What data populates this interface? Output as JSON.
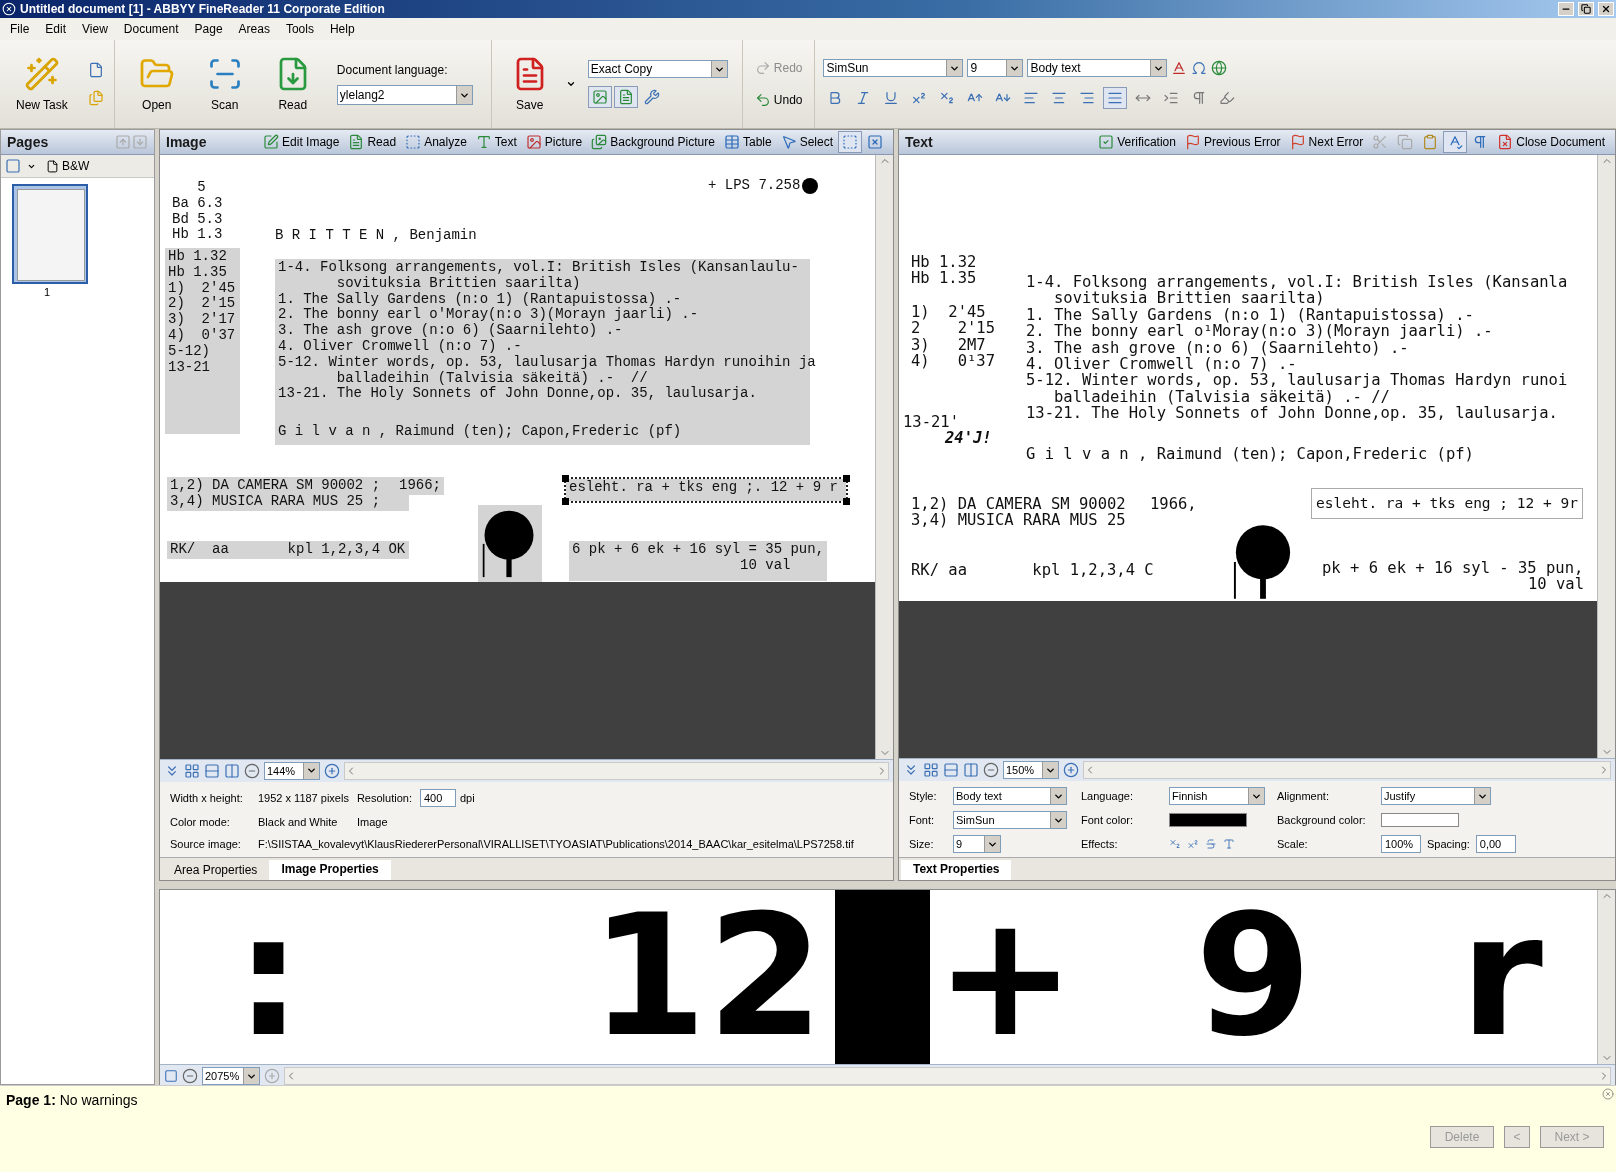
{
  "window": {
    "title": "Untitled document [1] - ABBYY FineReader 11 Corporate Edition"
  },
  "menu": [
    "File",
    "Edit",
    "View",
    "Document",
    "Page",
    "Areas",
    "Tools",
    "Help"
  ],
  "toolbar": {
    "new_task": "New Task",
    "open": "Open",
    "scan": "Scan",
    "read": "Read",
    "language_label": "Document language:",
    "language": "ylelang2",
    "save": "Save",
    "save_mode": "Exact Copy",
    "save_views": [
      {
        "kind": "picture",
        "selected": true
      },
      {
        "kind": "text",
        "selected": true
      }
    ],
    "redo": {
      "label": "Redo",
      "disabled": true
    },
    "undo": {
      "label": "Undo",
      "disabled": false
    },
    "font": "SimSun",
    "size": "9",
    "style": "Body text",
    "format": [
      {
        "kind": "bold",
        "selected": false
      },
      {
        "kind": "italic",
        "selected": false
      },
      {
        "kind": "underline",
        "selected": false
      },
      {
        "kind": "superscript",
        "selected": false
      },
      {
        "kind": "subscript",
        "selected": false
      },
      {
        "kind": "grow",
        "selected": false
      },
      {
        "kind": "shrink",
        "selected": false
      },
      {
        "kind": "align-left",
        "selected": false
      },
      {
        "kind": "align-center",
        "selected": false
      },
      {
        "kind": "align-right",
        "selected": false
      },
      {
        "kind": "justify",
        "selected": true
      },
      {
        "kind": "spacing",
        "selected": false
      },
      {
        "kind": "indent",
        "selected": false
      },
      {
        "kind": "paragraph",
        "selected": false
      },
      {
        "kind": "highlight",
        "selected": false
      }
    ]
  },
  "pages": {
    "title": "Pages",
    "view": "B&W",
    "thumbnails": [
      {
        "label": "1",
        "selected": true
      }
    ]
  },
  "image_panel": {
    "title": "Image",
    "tools": [
      {
        "kind": "edit-image",
        "label": "Edit Image",
        "selected": false
      },
      {
        "kind": "read",
        "label": "Read",
        "selected": false
      },
      {
        "kind": "analyze",
        "label": "Analyze",
        "selected": false
      },
      {
        "kind": "text",
        "label": "Text",
        "selected": false
      },
      {
        "kind": "picture",
        "label": "Picture",
        "selected": false
      },
      {
        "kind": "background-picture",
        "label": "Background Picture",
        "selected": false
      },
      {
        "kind": "table",
        "label": "Table",
        "selected": false
      },
      {
        "kind": "select",
        "label": "Select",
        "selected": false
      },
      {
        "kind": "select-area",
        "selected": true
      },
      {
        "kind": "clear-area",
        "selected": false
      }
    ],
    "areas": [
      {
        "kind": "text",
        "highlighted": false,
        "selected": false,
        "lines": [
          "   5",
          "Ba 6.3",
          "Bd 5.3",
          "Hb 1.3"
        ]
      },
      {
        "kind": "text",
        "highlighted": true,
        "selected": false,
        "lines": [
          "Hb 1.32",
          "Hb 1.35",
          "1)  2'45",
          "2)  2'15",
          "3)  2'17",
          "4)  0'37",
          "5-12)",
          "13-21"
        ]
      },
      {
        "kind": "stamp",
        "highlighted": false,
        "selected": false,
        "lines": [
          "+ LPS 7.258"
        ]
      },
      {
        "kind": "text",
        "highlighted": false,
        "selected": false,
        "lines": [
          "B R I T T E N , Benjamin"
        ]
      },
      {
        "kind": "text",
        "highlighted": true,
        "selected": false,
        "lines": [
          "1-4. Folksong arrangements, vol.I: British Isles (Kansanlaulu-",
          "       sovituksia Brittien saarilta)",
          "1. The Sally Gardens (n:o 1) (Rantapuistossa) .-",
          "2. The bonny earl o'Moray(n:o 3)(Morayn jaarli) .-",
          "3. The ash grove (n:o 6) (Saarnilehto) .-",
          "4. Oliver Cromwell (n:o 7) .-",
          "5-12. Winter words, op. 53, laulusarja Thomas Hardyn runoihin ja",
          "       balladeihin (Talvisia säkeitä) .-  //",
          "13-21. The Holy Sonnets of John Donne,op. 35, laulusarja.",
          "G i l v a n , Raimund (ten); Capon,Frederic (pf)"
        ]
      },
      {
        "kind": "text",
        "highlighted": true,
        "selected": false,
        "lines": [
          "1,2) DA CAMERA SM 90002 ;",
          "3,4) MUSICA RARA MUS 25 ;"
        ]
      },
      {
        "kind": "text",
        "highlighted": true,
        "selected": false,
        "lines": [
          "1966;"
        ]
      },
      {
        "kind": "text",
        "highlighted": true,
        "selected": true,
        "lines": [
          "esleht. ra + tks eng ;. 12 + 9 r"
        ]
      },
      {
        "kind": "picture",
        "highlighted": true,
        "selected": false
      },
      {
        "kind": "text",
        "highlighted": true,
        "selected": false,
        "lines": [
          "RK/  aa       kpl 1,2,3,4 OK"
        ]
      },
      {
        "kind": "text",
        "highlighted": true,
        "selected": false,
        "lines": [
          "6 pk + 6 ek + 16 syl = 35 pun,",
          "                    10 val"
        ]
      }
    ],
    "zoom": "144%",
    "width_height_label": "Width x height:",
    "width_height": "1952 x 1187 pixels",
    "resolution_label": "Resolution:",
    "resolution": "400",
    "resolution_unit": "dpi",
    "color_mode_label": "Color mode:",
    "color_mode": "Black and White",
    "color_mode_note": "Image",
    "source_label": "Source image:",
    "source": "F:\\SIISTAA_kovalevyt\\KlausRiedererPersonal\\VIRALLISET\\TYOASIAT\\Publications\\2014_BAAC\\kar_esitelma\\LPS7258.tif",
    "tabs": [
      {
        "label": "Area Properties",
        "selected": false
      },
      {
        "label": "Image Properties",
        "selected": true
      }
    ]
  },
  "text_panel": {
    "title": "Text",
    "tools": [
      {
        "kind": "verification",
        "label": "Verification",
        "selected": false,
        "disabled": false
      },
      {
        "kind": "previous-error",
        "label": "Previous Error",
        "selected": false,
        "disabled": false
      },
      {
        "kind": "next-error",
        "label": "Next Error",
        "selected": false,
        "disabled": false
      },
      {
        "kind": "cut",
        "selected": false,
        "disabled": true
      },
      {
        "kind": "copy",
        "selected": false,
        "disabled": true
      },
      {
        "kind": "paste",
        "selected": false,
        "disabled": false
      },
      {
        "kind": "spell",
        "selected": true,
        "disabled": false
      },
      {
        "kind": "paragraph",
        "selected": false,
        "disabled": false
      },
      {
        "kind": "close",
        "label": "Close Document",
        "selected": false,
        "disabled": false
      }
    ],
    "blocks": [
      {
        "kind": "text",
        "lines": [
          "Hb 1.32",
          "Hb 1.35"
        ]
      },
      {
        "kind": "text",
        "lines": [
          "1)  2'45",
          "2    2'15",
          "3)   2M7",
          "4)   0¹37"
        ]
      },
      {
        "kind": "text",
        "lines": [
          "13-21'"
        ]
      },
      {
        "kind": "bold",
        "lines": [
          "24'J!"
        ]
      },
      {
        "kind": "text",
        "lines": [
          "1-4. Folksong arrangements, vol.I: British Isles (Kansanla",
          "   sovituksia Brittien saarilta)",
          "1. The Sally Gardens (n:o 1) (Rantapuistossa) .-",
          "2. The bonny earl o¹Moray(n:o 3)(Morayn jaarli) .-",
          "3. The ash grove (n:o 6) (Saarnilehto) .-",
          "4. Oliver Cromwell (n:o 7) .-",
          "5-12. Winter words, op. 53, laulusarja Thomas Hardyn runoi",
          "   balladeihin (Talvisia säkeitä) .- //",
          "13-21. The Holy Sonnets of John Donne,op. 35, laulusarja."
        ]
      },
      {
        "kind": "text",
        "lines": [
          "G i l v a n , Raimund (ten); Capon,Frederic (pf)"
        ]
      },
      {
        "kind": "text",
        "lines": [
          "1,2) DA CAMERA SM 90002",
          "3,4) MUSICA RARA MUS 25"
        ]
      },
      {
        "kind": "text",
        "lines": [
          "1966,"
        ]
      },
      {
        "kind": "field",
        "lines": [
          "esleht. ra + tks eng ; 12 + 9r"
        ]
      },
      {
        "kind": "picture"
      },
      {
        "kind": "text",
        "lines": [
          "RK/ aa       kpl 1,2,3,4 C"
        ]
      },
      {
        "kind": "text",
        "lines": [
          "pk + 6 ek + 16 syl - 35 pun,",
          "10 val"
        ]
      }
    ],
    "zoom": "150%",
    "style_label": "Style:",
    "style": "Body text",
    "language_label": "Language:",
    "language": "Finnish",
    "alignment_label": "Alignment:",
    "alignment": "Justify",
    "font_label": "Font:",
    "font": "SimSun",
    "font_color_label": "Font color:",
    "background_color_label": "Background color:",
    "size_label": "Size:",
    "size": "9",
    "effects_label": "Effects:",
    "scale_label": "Scale:",
    "scale": "100%",
    "spacing_label": "Spacing:",
    "spacing": "0,00",
    "tabs": [
      {
        "label": "Text Properties",
        "selected": true
      }
    ]
  },
  "zoom_view": {
    "zoom": "2075%",
    "glyphs": [
      {
        "kind": "text",
        "text": ":"
      },
      {
        "kind": "text",
        "text": "12"
      },
      {
        "kind": "block"
      },
      {
        "kind": "text",
        "text": "+"
      },
      {
        "kind": "text",
        "text": "9"
      },
      {
        "kind": "text",
        "text": "r"
      }
    ]
  },
  "warnings": {
    "message": "**Page 1:** No warnings",
    "buttons": [
      {
        "label": "Delete",
        "disabled": true
      },
      {
        "label": "<",
        "disabled": true
      },
      {
        "label": "Next >",
        "disabled": true
      }
    ]
  }
}
